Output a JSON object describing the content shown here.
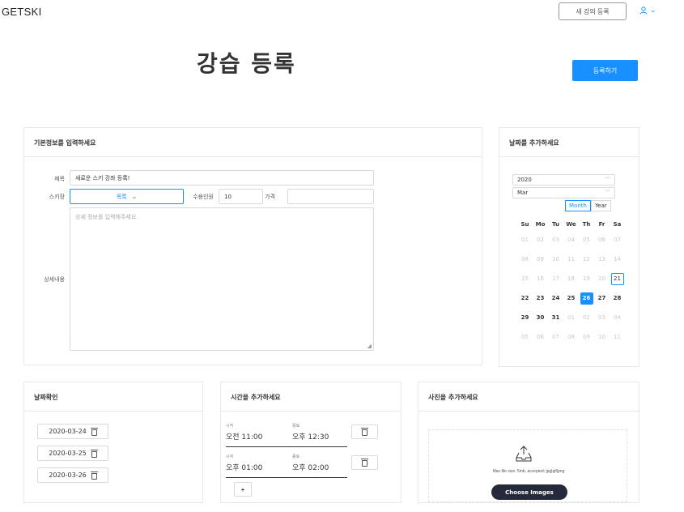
{
  "header": {
    "brand": "GETSKI",
    "new_lecture": "새 강의 등록",
    "user_chevron": "⌄"
  },
  "page": {
    "title": "강습 등록",
    "submit": "등록하기"
  },
  "basic_info": {
    "heading": "기본정보를 입력하세요",
    "title_label": "제목",
    "title_value": "새로운 스키 강좌 등록!",
    "resort_label": "스키장",
    "resort_value": "목록",
    "capacity_label": "수용인원",
    "capacity_value": "10",
    "price_label": "가격",
    "price_value": "",
    "details_label": "상세내용",
    "details_placeholder": "상세 정보를 입력해주세요."
  },
  "calendar": {
    "heading": "날짜를 추가하세요",
    "year": "2020",
    "month": "Mar",
    "mode_month": "Month",
    "mode_year": "Year",
    "weekdays": [
      "Su",
      "Mo",
      "Tu",
      "We",
      "Th",
      "Fr",
      "Sa"
    ],
    "days": [
      {
        "d": "01",
        "s": "dim"
      },
      {
        "d": "02",
        "s": "dim"
      },
      {
        "d": "03",
        "s": "dim"
      },
      {
        "d": "04",
        "s": "dim"
      },
      {
        "d": "05",
        "s": "dim"
      },
      {
        "d": "06",
        "s": "dim"
      },
      {
        "d": "07",
        "s": "dim"
      },
      {
        "d": "08",
        "s": "dim"
      },
      {
        "d": "09",
        "s": "dim"
      },
      {
        "d": "10",
        "s": "dim"
      },
      {
        "d": "11",
        "s": "dim"
      },
      {
        "d": "12",
        "s": "dim"
      },
      {
        "d": "13",
        "s": "dim"
      },
      {
        "d": "14",
        "s": "dim"
      },
      {
        "d": "15",
        "s": "dim"
      },
      {
        "d": "16",
        "s": "dim"
      },
      {
        "d": "17",
        "s": "dim"
      },
      {
        "d": "18",
        "s": "dim"
      },
      {
        "d": "19",
        "s": "dim"
      },
      {
        "d": "20",
        "s": "dim"
      },
      {
        "d": "21",
        "s": "today"
      },
      {
        "d": "22",
        "s": "now"
      },
      {
        "d": "23",
        "s": "now"
      },
      {
        "d": "24",
        "s": "now"
      },
      {
        "d": "25",
        "s": "now"
      },
      {
        "d": "26",
        "s": "sel"
      },
      {
        "d": "27",
        "s": "now"
      },
      {
        "d": "28",
        "s": "now"
      },
      {
        "d": "29",
        "s": "now"
      },
      {
        "d": "30",
        "s": "now"
      },
      {
        "d": "31",
        "s": "now"
      },
      {
        "d": "01",
        "s": "dim"
      },
      {
        "d": "02",
        "s": "dim"
      },
      {
        "d": "03",
        "s": "dim"
      },
      {
        "d": "04",
        "s": "dim"
      },
      {
        "d": "05",
        "s": "dim"
      },
      {
        "d": "06",
        "s": "dim"
      },
      {
        "d": "07",
        "s": "dim"
      },
      {
        "d": "08",
        "s": "dim"
      },
      {
        "d": "09",
        "s": "dim"
      },
      {
        "d": "10",
        "s": "dim"
      },
      {
        "d": "11",
        "s": "dim"
      }
    ]
  },
  "date_confirm": {
    "heading": "날짜확인",
    "dates": [
      "2020-03-24",
      "2020-03-25",
      "2020-03-26"
    ]
  },
  "time_add": {
    "heading": "시간을 추가하세요",
    "start_label": "시작",
    "end_label": "종료",
    "slots": [
      {
        "start": "오전 11:00",
        "end": "오후 12:30"
      },
      {
        "start": "오후 01:00",
        "end": "오후 02:00"
      }
    ],
    "add": "+"
  },
  "photo_add": {
    "heading": "사진을 추가하세요",
    "hint": "Max file size: 5mb, accepted: jpg|gif|png",
    "choose": "Choose Images"
  },
  "colors": {
    "primary": "#1890ff",
    "dark_button": "#252a3a",
    "border": "#e8e8e8"
  }
}
